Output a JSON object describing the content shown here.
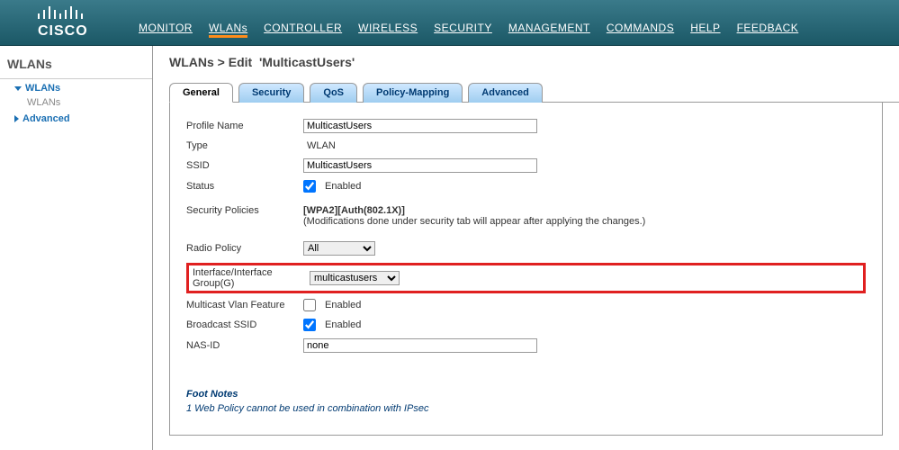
{
  "brand": "cisco",
  "nav": {
    "items": [
      "MONITOR",
      "WLANs",
      "CONTROLLER",
      "WIRELESS",
      "SECURITY",
      "MANAGEMENT",
      "COMMANDS",
      "HELP",
      "FEEDBACK"
    ],
    "active": "WLANs"
  },
  "sidebar": {
    "title": "WLANs",
    "items": [
      {
        "label": "WLANs",
        "sub": "WLANs",
        "expanded": true
      },
      {
        "label": "Advanced",
        "expanded": false
      }
    ]
  },
  "page": {
    "title_prefix": "WLANs > Edit",
    "title_name": "'MulticastUsers'"
  },
  "tabs": {
    "items": [
      "General",
      "Security",
      "QoS",
      "Policy-Mapping",
      "Advanced"
    ],
    "active": "General"
  },
  "form": {
    "profile_name_label": "Profile Name",
    "profile_name_value": "MulticastUsers",
    "type_label": "Type",
    "type_value": "WLAN",
    "ssid_label": "SSID",
    "ssid_value": "MulticastUsers",
    "status_label": "Status",
    "status_enabled_label": "Enabled",
    "status_checked": true,
    "secpol_label": "Security Policies",
    "secpol_value": "[WPA2][Auth(802.1X)]",
    "secpol_note": "(Modifications done under security tab will appear after applying the changes.)",
    "radio_policy_label": "Radio Policy",
    "radio_policy_value": "All",
    "iface_label_1": "Interface/Interface",
    "iface_label_2": "Group(G)",
    "iface_value": "multicastusers",
    "mcast_label": "Multicast Vlan Feature",
    "mcast_enabled_label": "Enabled",
    "mcast_checked": false,
    "bcast_label": "Broadcast SSID",
    "bcast_enabled_label": "Enabled",
    "bcast_checked": true,
    "nasid_label": "NAS-ID",
    "nasid_value": "none"
  },
  "foot": {
    "title": "Foot Notes",
    "note1": "1 Web Policy cannot be used in combination with IPsec"
  }
}
